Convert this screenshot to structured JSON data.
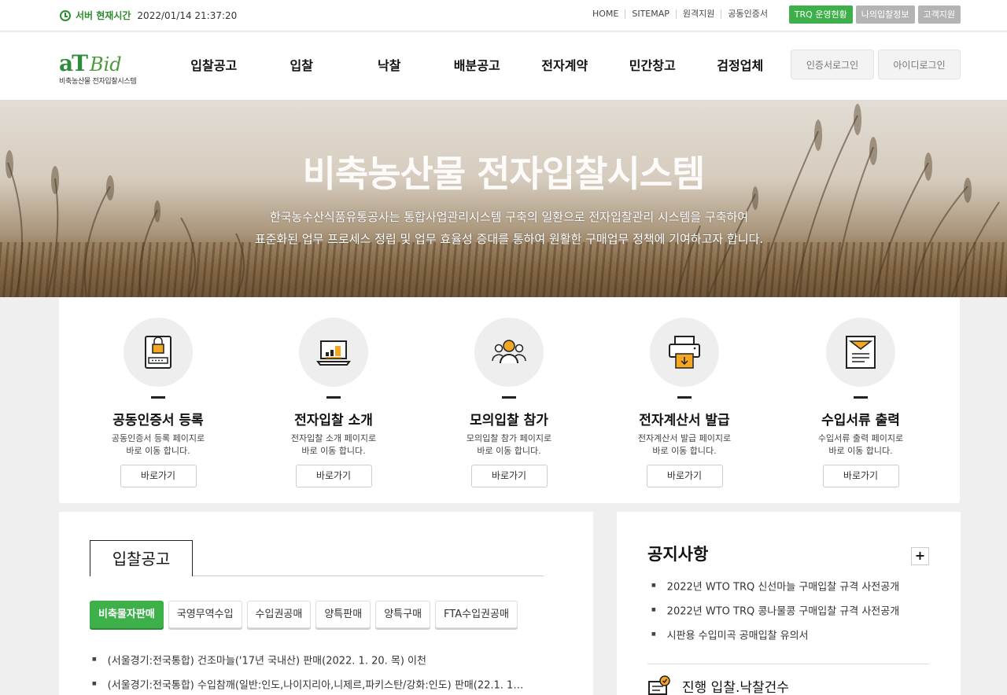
{
  "topbar": {
    "server_time_label": "서버 현재시간",
    "server_time": "2022/01/14 21:37:20",
    "links": [
      "HOME",
      "SITEMAP",
      "원격지원",
      "공동인증서"
    ],
    "buttons": [
      "TRQ 운영현황",
      "나의입찰정보",
      "고객지원"
    ]
  },
  "logo": {
    "mark_at": "aT",
    "mark_bid": "Bid",
    "subtitle": "비축농산물 전자입찰시스템"
  },
  "nav": [
    "입찰공고",
    "입찰",
    "낙찰",
    "배분공고",
    "전자계약",
    "민간창고",
    "검정업체"
  ],
  "login": {
    "cert_login": "인증서로그인",
    "id_login": "아이디로그인"
  },
  "hero": {
    "title": "비축농산물 전자입찰시스템",
    "desc_line1": "한국농수산식품유통공사는 통합사업관리시스템 구축의 일환으로 전자입찰관리 시스템을 구축하여",
    "desc_line2": "표준화된 업무 프로세스 정립 및 업무 효율성 증대를 통하여 원활한 구매업무 정책에 기여하고자 합니다."
  },
  "quick_links": [
    {
      "icon": "certificate-icon",
      "title": "공동인증서 등록",
      "desc1": "공동인증서 등록 페이지로",
      "desc2": "바로 이동 합니다.",
      "button": "바로가기"
    },
    {
      "icon": "laptop-chart-icon",
      "title": "전자입찰 소개",
      "desc1": "전자입찰 소개 페이지로",
      "desc2": "바로 이동 합니다.",
      "button": "바로가기"
    },
    {
      "icon": "people-icon",
      "title": "모의입찰 참가",
      "desc1": "모의입찰 참가 페이지로",
      "desc2": "바로 이동 합니다.",
      "button": "바로가기"
    },
    {
      "icon": "printer-icon",
      "title": "전자계산서 발급",
      "desc1": "전자계산서 발급 페이지로",
      "desc2": "바로 이동 합니다.",
      "button": "바로가기"
    },
    {
      "icon": "document-icon",
      "title": "수입서류 출력",
      "desc1": "수입서류 출력 페이지로",
      "desc2": "바로 이동 합니다.",
      "button": "바로가기"
    }
  ],
  "bid_notice": {
    "tab_title": "입찰공고",
    "categories": [
      "비축물자판매",
      "국영무역수입",
      "수입권공매",
      "양특판매",
      "양특구매",
      "FTA수입권공매"
    ],
    "active_category": "비축물자판매",
    "items": [
      "(서울경기:전국통합) 건조마늘('17년 국내산) 판매(2022. 1. 20. 목) 이천",
      "(서울경기:전국통합) 수입참깨(일반:인도,나이지리아,니제르,파키스탄/강화:인도) 판매(22.1. 1…"
    ]
  },
  "notice": {
    "title": "공지사항",
    "more": "+",
    "items": [
      "2022년 WTO TRQ 신선마늘 구매입찰 규격 사전공개",
      "2022년 WTO TRQ 콩나물콩 구매입찰 규격 사전공개",
      "시판용 수입미곡 공매입찰 유의서"
    ],
    "progress_label": "진행 입찰.낙찰건수"
  },
  "colors": {
    "brand_green": "#3db04a",
    "dark_green": "#2e8b2e",
    "gray_button": "#b3b3b3"
  }
}
